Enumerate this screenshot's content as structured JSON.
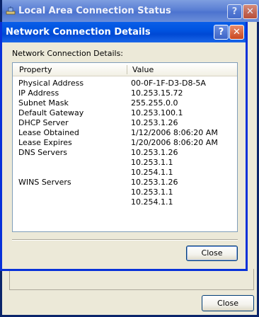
{
  "back_window": {
    "title": "Local Area Connection Status",
    "help_button": "?",
    "close_button": "✕",
    "close_label": "Close"
  },
  "dialog": {
    "title": "Network Connection Details",
    "help_button": "?",
    "close_button": "✕",
    "section_label": "Network Connection Details:",
    "columns": [
      "Property",
      "Value"
    ],
    "rows": [
      {
        "property": "Physical Address",
        "value": "00-0F-1F-D3-D8-5A"
      },
      {
        "property": "IP Address",
        "value": "10.253.15.72"
      },
      {
        "property": "Subnet Mask",
        "value": "255.255.0.0"
      },
      {
        "property": "Default Gateway",
        "value": "10.253.100.1"
      },
      {
        "property": "DHCP Server",
        "value": "10.253.1.26"
      },
      {
        "property": "Lease Obtained",
        "value": "1/12/2006 8:06:20 AM"
      },
      {
        "property": "Lease Expires",
        "value": "1/20/2006 8:06:20 AM"
      },
      {
        "property": "DNS Servers",
        "value": "10.253.1.26"
      },
      {
        "property": "",
        "value": "10.253.1.1"
      },
      {
        "property": "",
        "value": "10.254.1.1"
      },
      {
        "property": "WINS Servers",
        "value": "10.253.1.26"
      },
      {
        "property": "",
        "value": "10.253.1.1"
      },
      {
        "property": "",
        "value": "10.254.1.1"
      }
    ],
    "close_label": "Close"
  },
  "icons": {
    "window_icon": "network-connection-icon"
  }
}
